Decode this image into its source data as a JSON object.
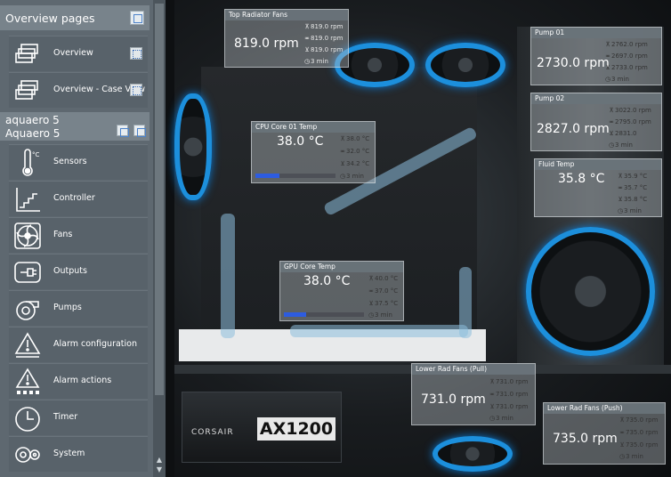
{
  "sidebar": {
    "overview_header": "Overview pages",
    "overview_items": [
      {
        "label": "Overview"
      },
      {
        "label": "Overview - Case View"
      }
    ],
    "device_header": {
      "line1": "aquaero 5",
      "line2": "Aquaero 5"
    },
    "device_items": [
      {
        "label": "Sensors",
        "icon": "thermometer-icon"
      },
      {
        "label": "Controller",
        "icon": "controller-icon"
      },
      {
        "label": "Fans",
        "icon": "fan-icon"
      },
      {
        "label": "Outputs",
        "icon": "outputs-icon"
      },
      {
        "label": "Pumps",
        "icon": "pump-icon"
      },
      {
        "label": "Alarm configuration",
        "icon": "alarm-config-icon"
      },
      {
        "label": "Alarm actions",
        "icon": "alarm-actions-icon"
      },
      {
        "label": "Timer",
        "icon": "timer-icon"
      },
      {
        "label": "System",
        "icon": "system-icon"
      }
    ]
  },
  "psu": {
    "brand": "CORSAIR",
    "model": "AX1200"
  },
  "panels": {
    "top_radiator_fans": {
      "title": "Top Radiator Fans",
      "value": "819.0 rpm",
      "max": "819.0 rpm",
      "avg": "819.0 rpm",
      "min": "819.0 rpm",
      "interval": "3 min"
    },
    "pump01": {
      "title": "Pump 01",
      "value": "2730.0 rpm",
      "max": "2762.0 rpm",
      "avg": "2697.0 rpm",
      "min": "2733.0 rpm",
      "interval": "3 min"
    },
    "cpu_core": {
      "title": "CPU Core 01 Temp",
      "value": "38.0 °C",
      "max": "38.0 °C",
      "avg": "32.0 °C",
      "min": "34.2 °C",
      "interval": "3 min",
      "level": 0.3
    },
    "pump02": {
      "title": "Pump 02",
      "value": "2827.0 rpm",
      "max": "3022.0 rpm",
      "avg": "2795.0 rpm",
      "min": "2831.0",
      "interval": "3 min"
    },
    "fluid_temp": {
      "title": "Fluid Temp",
      "value": "35.8 °C",
      "max": "35.9 °C",
      "avg": "35.7 °C",
      "min": "35.8 °C",
      "interval": "3 min"
    },
    "gpu_core": {
      "title": "GPU Core Temp",
      "value": "38.0 °C",
      "max": "40.0 °C",
      "avg": "37.0 °C",
      "min": "37.5 °C",
      "interval": "3 min",
      "level": 0.28
    },
    "lower_pull": {
      "title": "Lower Rad Fans (Pull)",
      "value": "731.0 rpm",
      "max": "731.0 rpm",
      "avg": "731.0 rpm",
      "min": "731.0 rpm",
      "interval": "3 min"
    },
    "lower_push": {
      "title": "Lower Rad Fans (Push)",
      "value": "735.0 rpm",
      "max": "735.0 rpm",
      "avg": "735.0 rpm",
      "min": "735.0 rpm",
      "interval": "3 min"
    }
  },
  "colors": {
    "accent": "#1c8fdc",
    "bar": "#2d5ce0"
  }
}
